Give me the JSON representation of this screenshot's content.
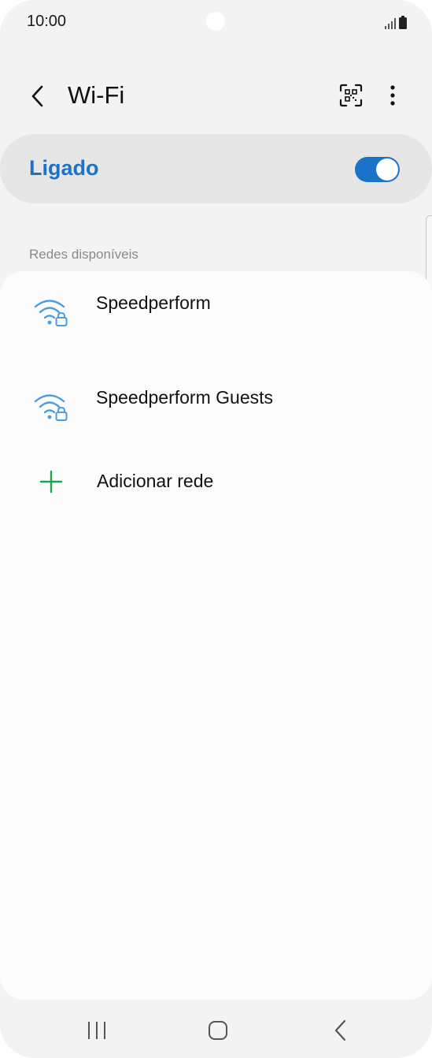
{
  "status_bar": {
    "time": "10:00"
  },
  "header": {
    "title": "Wi-Fi",
    "back_icon": "chevron-left-icon",
    "qr_icon": "qr-scan-icon",
    "more_icon": "more-vertical-icon"
  },
  "master_switch": {
    "label": "Ligado",
    "on": true
  },
  "networks": {
    "section_label": "Redes disponíveis",
    "items": [
      {
        "name": "Speedperform",
        "icon": "wifi-locked-icon"
      },
      {
        "name": "Speedperform Guests",
        "icon": "wifi-locked-icon"
      }
    ],
    "add_label": "Adicionar rede",
    "add_icon": "plus-icon"
  },
  "colors": {
    "accent": "#1a73c9",
    "wifi_icon": "#4a9de3",
    "add_icon": "#1fa34a",
    "background": "#f3f3f3",
    "card": "#fcfcfc"
  }
}
